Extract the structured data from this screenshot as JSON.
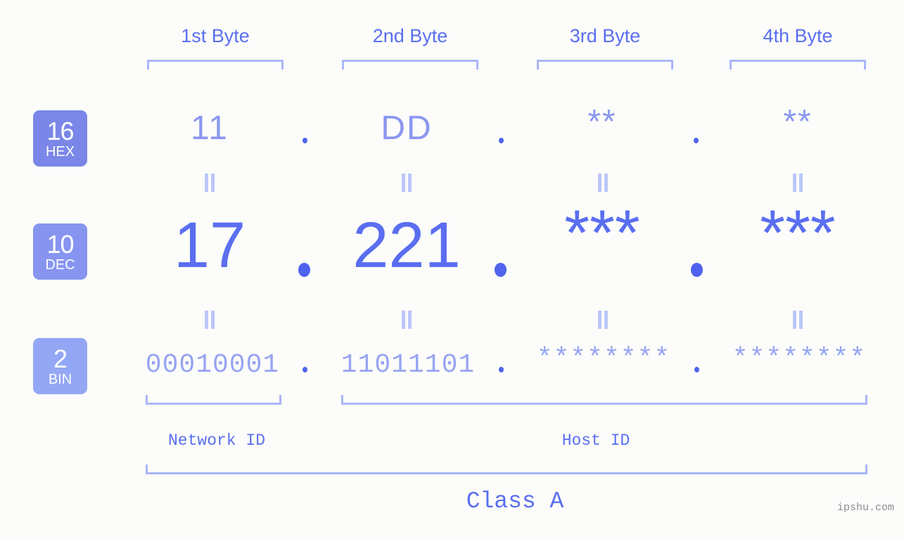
{
  "meta": {
    "watermark": "ipshu.com",
    "background_color": "#fcfdfa",
    "accent_color": "#5a6ef0",
    "accent_light_color": "#8b97ef",
    "bracket_color": "#aab6f7"
  },
  "byte_headers": [
    {
      "label": "1st Byte"
    },
    {
      "label": "2nd Byte"
    },
    {
      "label": "3rd Byte"
    },
    {
      "label": "4th Byte"
    }
  ],
  "rows": [
    {
      "badge_number": "16",
      "badge_name": "HEX",
      "badge_color": "#7a87e8",
      "values": [
        "11",
        "DD",
        "**",
        "**"
      ],
      "separators": [
        ".",
        ".",
        "."
      ]
    },
    {
      "badge_number": "10",
      "badge_name": "DEC",
      "badge_color": "#8795f0",
      "values": [
        "17",
        "221",
        "***",
        "***"
      ],
      "separators": [
        ".",
        ".",
        "."
      ]
    },
    {
      "badge_number": "2",
      "badge_name": "BIN",
      "badge_color": "#93a7f5",
      "values": [
        "00010001",
        "11011101",
        "********",
        "********"
      ],
      "separators": [
        ".",
        ".",
        "."
      ]
    }
  ],
  "equals_marks": {
    "glyph": "||",
    "count_per_row": 4
  },
  "id_sections": [
    {
      "label": "Network ID"
    },
    {
      "label": "Host ID"
    }
  ],
  "class_label": "Class A"
}
